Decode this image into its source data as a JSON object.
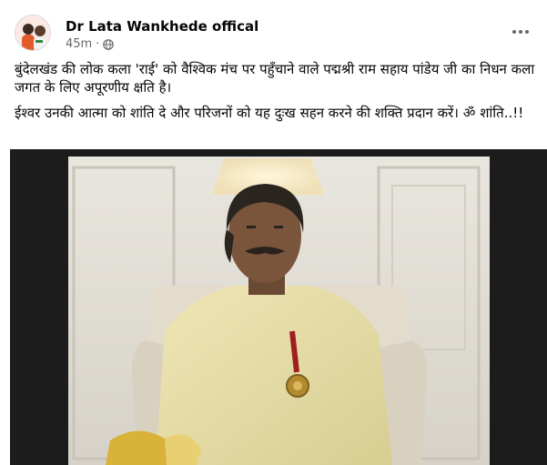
{
  "post": {
    "author": "Dr Lata Wankhede offical",
    "time": "45m",
    "dot": "·",
    "paragraph1": "बुंदेलखंड की लोक कला 'राई' को वैश्विक मंच पर पहुँचाने वाले पद्मश्री राम सहाय पांडेय जी का निधन कला जगत के लिए अपूरणीय क्षति है।",
    "paragraph2": "ईश्वर उनकी आत्मा को शांति दे और परिजनों को यह दुःख सहन करने की शक्ति प्रदान करें। ॐ शांति..!!"
  },
  "icons": {
    "audience": "globe-icon",
    "menu": "more-options-icon"
  },
  "colors": {
    "text_primary": "#050505",
    "text_secondary": "#65676b",
    "card_bg": "#ffffff",
    "photo_frame": "#1c1c1c"
  }
}
